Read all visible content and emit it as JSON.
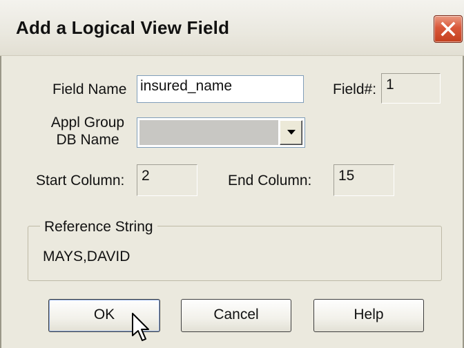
{
  "window": {
    "title": "Add a Logical View Field",
    "close_icon": "close-icon"
  },
  "form": {
    "field_name_label": "Field Name",
    "field_name_value": "insured_name",
    "field_num_label": "Field#:",
    "field_num_value": "1",
    "appl_group_label_line1": "Appl Group",
    "appl_group_label_line2": "DB Name",
    "appl_group_value": "",
    "start_column_label": "Start Column:",
    "start_column_value": "2",
    "end_column_label": "End Column:",
    "end_column_value": "15"
  },
  "reference": {
    "legend": "Reference String",
    "value": "MAYS,DAVID"
  },
  "buttons": {
    "ok": "OK",
    "cancel": "Cancel",
    "help": "Help"
  },
  "colors": {
    "close_button": "#d9583a",
    "dialog_background": "#ebe9de"
  }
}
